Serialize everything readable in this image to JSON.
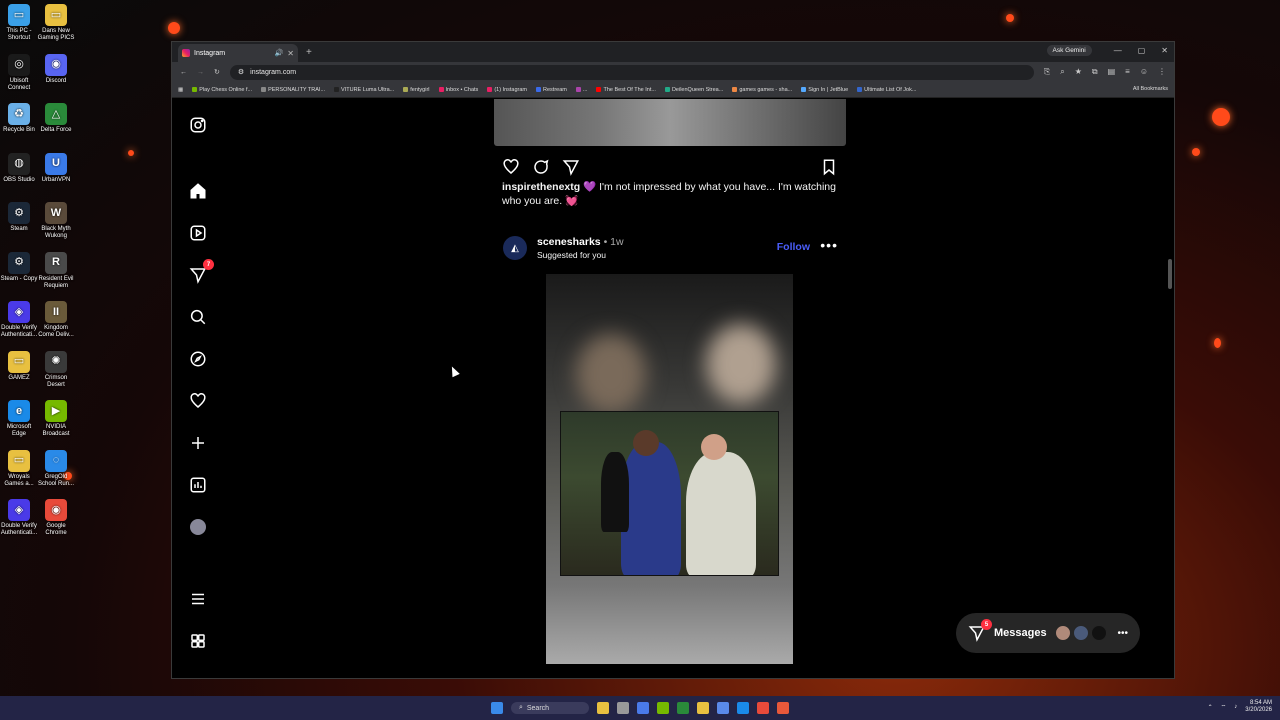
{
  "desktop": {
    "icons": [
      {
        "label": "This PC - Shortcut",
        "color": "#3aa0e8",
        "glyph": "▭"
      },
      {
        "label": "Dans New Gaming PICS",
        "color": "#e8c040",
        "glyph": "▭"
      },
      {
        "label": "Ubisoft Connect",
        "color": "#1a1a1a",
        "glyph": "◎"
      },
      {
        "label": "Discord",
        "color": "#5865f2",
        "glyph": "◉"
      },
      {
        "label": "Recycle Bin",
        "color": "#6ab0e8",
        "glyph": "♻"
      },
      {
        "label": "Delta Force",
        "color": "#2a8a3a",
        "glyph": "△"
      },
      {
        "label": "OBS Studio",
        "color": "#222",
        "glyph": "◍"
      },
      {
        "label": "UrbanVPN",
        "color": "#3a7ae8",
        "glyph": "U"
      },
      {
        "label": "Steam",
        "color": "#1b2838",
        "glyph": "⚙"
      },
      {
        "label": "Black Myth Wukong",
        "color": "#5a4a3a",
        "glyph": "W"
      },
      {
        "label": "Steam - Copy",
        "color": "#1b2838",
        "glyph": "⚙"
      },
      {
        "label": "Resident Evil Requiem",
        "color": "#4a4a4a",
        "glyph": "R"
      },
      {
        "label": "Double Verify Authenticati...",
        "color": "#4a3ae8",
        "glyph": "◈"
      },
      {
        "label": "Kingdom Come Deliv...",
        "color": "#6a5a3a",
        "glyph": "II"
      },
      {
        "label": "GAMEZ",
        "color": "#e8c040",
        "glyph": "▭"
      },
      {
        "label": "Crimson Desert",
        "color": "#3a3a3a",
        "glyph": "✺"
      },
      {
        "label": "Microsoft Edge",
        "color": "#1a8ae8",
        "glyph": "e"
      },
      {
        "label": "NVIDIA Broadcast",
        "color": "#76b900",
        "glyph": "▶"
      },
      {
        "label": "Wroyals Games a...",
        "color": "#e8c040",
        "glyph": "▭"
      },
      {
        "label": "GregOld School Run...",
        "color": "#2a8ae8",
        "glyph": "◌"
      },
      {
        "label": "Double Verify Authenticati...",
        "color": "#4a3ae8",
        "glyph": "◈"
      },
      {
        "label": "Google Chrome",
        "color": "#e84a3a",
        "glyph": "◉"
      }
    ]
  },
  "browser": {
    "tab_title": "Instagram",
    "url": "instagram.com",
    "ask_gemini": "Ask Gemini",
    "bookmarks": [
      "Play Chess Online f...",
      "PERSONALITY TRAI...",
      "VITURE Luma Ultra...",
      "fentygirl",
      "Inbox • Chats",
      "(1) Instagram",
      "Restream",
      "...",
      "The Best Of The Int...",
      "DeilenQueen Strea...",
      "games games - sha...",
      "Sign In | JetBlue",
      "Ultimate List Of Jok..."
    ],
    "all_bookmarks": "All Bookmarks"
  },
  "instagram": {
    "nav_badge": "7",
    "caption_user": "inspirethenextg",
    "caption_emoji": "💜",
    "caption_text": "I'm not impressed by what you have... I'm watching who you are.",
    "caption_end_emoji": "💓",
    "post_user": "sceneshar​ks",
    "post_time": "• 1w",
    "post_sub": "Suggested for you",
    "follow": "Follow",
    "messages_label": "Messages",
    "messages_badge": "5",
    "avatar_colors": [
      "#b08a7a",
      "#4a5a7a",
      "#111"
    ]
  },
  "taskbar": {
    "search": "Search",
    "time": "8:54 AM",
    "date": "3/20/2026"
  }
}
